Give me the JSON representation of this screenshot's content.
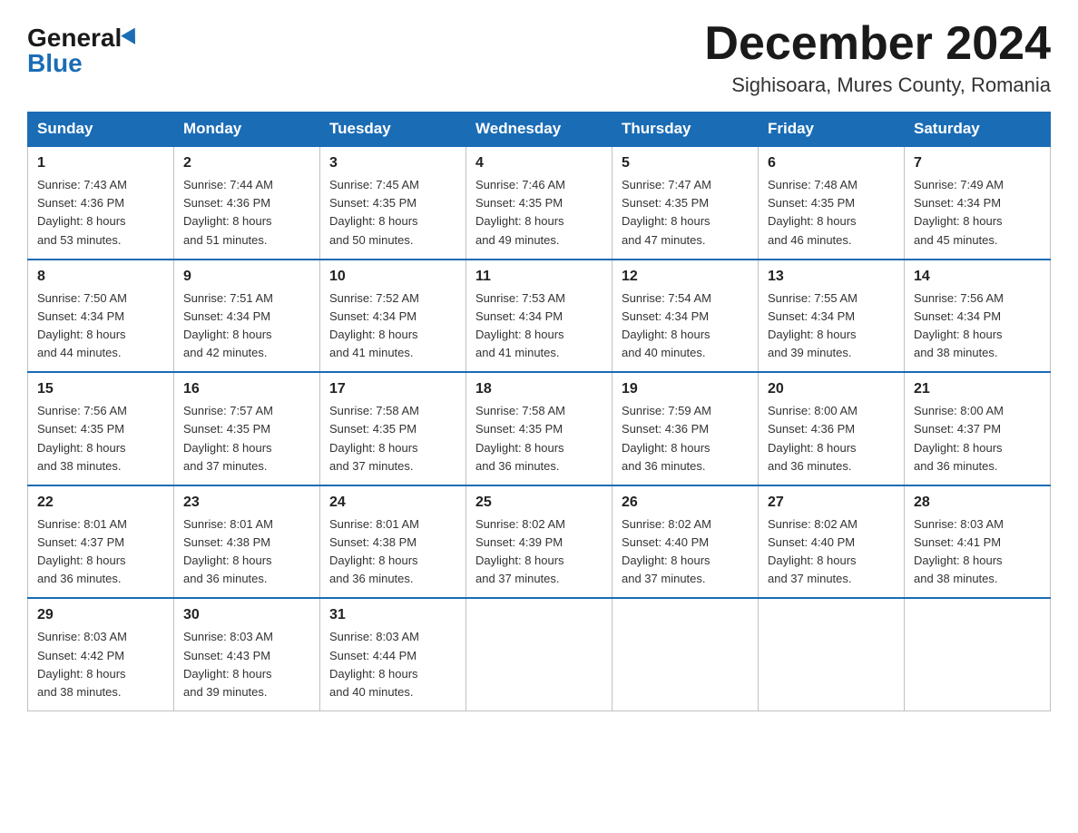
{
  "logo": {
    "general": "General",
    "blue": "Blue",
    "alt": "GeneralBlue logo"
  },
  "header": {
    "month_year": "December 2024",
    "location": "Sighisoara, Mures County, Romania"
  },
  "weekdays": [
    "Sunday",
    "Monday",
    "Tuesday",
    "Wednesday",
    "Thursday",
    "Friday",
    "Saturday"
  ],
  "weeks": [
    [
      {
        "day": "1",
        "info": "Sunrise: 7:43 AM\nSunset: 4:36 PM\nDaylight: 8 hours\nand 53 minutes."
      },
      {
        "day": "2",
        "info": "Sunrise: 7:44 AM\nSunset: 4:36 PM\nDaylight: 8 hours\nand 51 minutes."
      },
      {
        "day": "3",
        "info": "Sunrise: 7:45 AM\nSunset: 4:35 PM\nDaylight: 8 hours\nand 50 minutes."
      },
      {
        "day": "4",
        "info": "Sunrise: 7:46 AM\nSunset: 4:35 PM\nDaylight: 8 hours\nand 49 minutes."
      },
      {
        "day": "5",
        "info": "Sunrise: 7:47 AM\nSunset: 4:35 PM\nDaylight: 8 hours\nand 47 minutes."
      },
      {
        "day": "6",
        "info": "Sunrise: 7:48 AM\nSunset: 4:35 PM\nDaylight: 8 hours\nand 46 minutes."
      },
      {
        "day": "7",
        "info": "Sunrise: 7:49 AM\nSunset: 4:34 PM\nDaylight: 8 hours\nand 45 minutes."
      }
    ],
    [
      {
        "day": "8",
        "info": "Sunrise: 7:50 AM\nSunset: 4:34 PM\nDaylight: 8 hours\nand 44 minutes."
      },
      {
        "day": "9",
        "info": "Sunrise: 7:51 AM\nSunset: 4:34 PM\nDaylight: 8 hours\nand 42 minutes."
      },
      {
        "day": "10",
        "info": "Sunrise: 7:52 AM\nSunset: 4:34 PM\nDaylight: 8 hours\nand 41 minutes."
      },
      {
        "day": "11",
        "info": "Sunrise: 7:53 AM\nSunset: 4:34 PM\nDaylight: 8 hours\nand 41 minutes."
      },
      {
        "day": "12",
        "info": "Sunrise: 7:54 AM\nSunset: 4:34 PM\nDaylight: 8 hours\nand 40 minutes."
      },
      {
        "day": "13",
        "info": "Sunrise: 7:55 AM\nSunset: 4:34 PM\nDaylight: 8 hours\nand 39 minutes."
      },
      {
        "day": "14",
        "info": "Sunrise: 7:56 AM\nSunset: 4:34 PM\nDaylight: 8 hours\nand 38 minutes."
      }
    ],
    [
      {
        "day": "15",
        "info": "Sunrise: 7:56 AM\nSunset: 4:35 PM\nDaylight: 8 hours\nand 38 minutes."
      },
      {
        "day": "16",
        "info": "Sunrise: 7:57 AM\nSunset: 4:35 PM\nDaylight: 8 hours\nand 37 minutes."
      },
      {
        "day": "17",
        "info": "Sunrise: 7:58 AM\nSunset: 4:35 PM\nDaylight: 8 hours\nand 37 minutes."
      },
      {
        "day": "18",
        "info": "Sunrise: 7:58 AM\nSunset: 4:35 PM\nDaylight: 8 hours\nand 36 minutes."
      },
      {
        "day": "19",
        "info": "Sunrise: 7:59 AM\nSunset: 4:36 PM\nDaylight: 8 hours\nand 36 minutes."
      },
      {
        "day": "20",
        "info": "Sunrise: 8:00 AM\nSunset: 4:36 PM\nDaylight: 8 hours\nand 36 minutes."
      },
      {
        "day": "21",
        "info": "Sunrise: 8:00 AM\nSunset: 4:37 PM\nDaylight: 8 hours\nand 36 minutes."
      }
    ],
    [
      {
        "day": "22",
        "info": "Sunrise: 8:01 AM\nSunset: 4:37 PM\nDaylight: 8 hours\nand 36 minutes."
      },
      {
        "day": "23",
        "info": "Sunrise: 8:01 AM\nSunset: 4:38 PM\nDaylight: 8 hours\nand 36 minutes."
      },
      {
        "day": "24",
        "info": "Sunrise: 8:01 AM\nSunset: 4:38 PM\nDaylight: 8 hours\nand 36 minutes."
      },
      {
        "day": "25",
        "info": "Sunrise: 8:02 AM\nSunset: 4:39 PM\nDaylight: 8 hours\nand 37 minutes."
      },
      {
        "day": "26",
        "info": "Sunrise: 8:02 AM\nSunset: 4:40 PM\nDaylight: 8 hours\nand 37 minutes."
      },
      {
        "day": "27",
        "info": "Sunrise: 8:02 AM\nSunset: 4:40 PM\nDaylight: 8 hours\nand 37 minutes."
      },
      {
        "day": "28",
        "info": "Sunrise: 8:03 AM\nSunset: 4:41 PM\nDaylight: 8 hours\nand 38 minutes."
      }
    ],
    [
      {
        "day": "29",
        "info": "Sunrise: 8:03 AM\nSunset: 4:42 PM\nDaylight: 8 hours\nand 38 minutes."
      },
      {
        "day": "30",
        "info": "Sunrise: 8:03 AM\nSunset: 4:43 PM\nDaylight: 8 hours\nand 39 minutes."
      },
      {
        "day": "31",
        "info": "Sunrise: 8:03 AM\nSunset: 4:44 PM\nDaylight: 8 hours\nand 40 minutes."
      },
      {
        "day": "",
        "info": ""
      },
      {
        "day": "",
        "info": ""
      },
      {
        "day": "",
        "info": ""
      },
      {
        "day": "",
        "info": ""
      }
    ]
  ]
}
